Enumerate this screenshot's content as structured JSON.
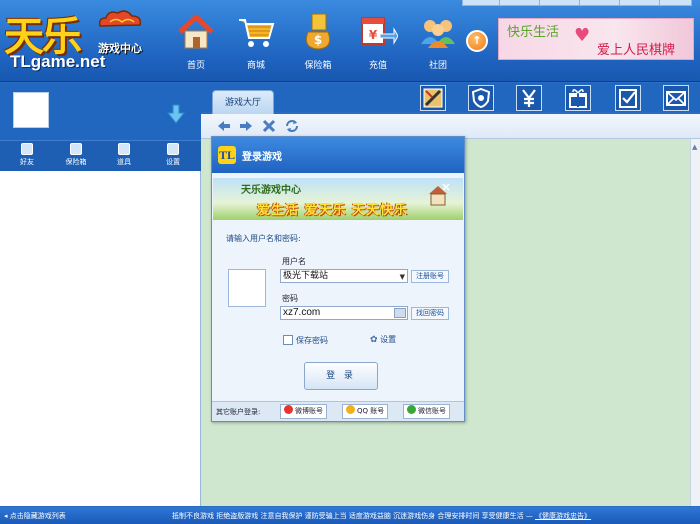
{
  "header": {
    "logo_big": "天乐",
    "logo_sub": "游戏中心",
    "logo_url": "TLgame.net",
    "nav": [
      {
        "label": "首页",
        "icon": "home-icon"
      },
      {
        "label": "商城",
        "icon": "shopping-cart-icon"
      },
      {
        "label": "保险箱",
        "icon": "money-bag-icon"
      },
      {
        "label": "充值",
        "icon": "recharge-card-icon"
      },
      {
        "label": "社团",
        "icon": "community-people-icon"
      }
    ],
    "banner": {
      "line1": "快乐生活",
      "line2": "爱上人民棋牌"
    }
  },
  "tabs": [
    {
      "label": "游戏大厅"
    }
  ],
  "toolbar_icons": [
    "map-icon",
    "shield-icon",
    "yen-icon",
    "gift-icon",
    "checklist-icon",
    "mail-icon"
  ],
  "left_panel": {
    "tools": [
      {
        "label": "好友",
        "icon": "friends-icon"
      },
      {
        "label": "保险箱",
        "icon": "safe-icon"
      },
      {
        "label": "道具",
        "icon": "props-icon"
      },
      {
        "label": "设置",
        "icon": "settings-icon"
      }
    ]
  },
  "login_dialog": {
    "title": "登录游戏",
    "logo_text": "TL",
    "banner_line1": "天乐游戏中心",
    "banner_line2": "爱生活  爱天乐  天天快乐",
    "prompt": "请输入用户名和密码:",
    "username_label": "用户名",
    "username_value": "极光下载站",
    "register_link": "注册账号",
    "password_label": "密码",
    "password_value": "xz7.com",
    "find_password_link": "找回密码",
    "remember_label": "保存密码",
    "settings_label": "设置",
    "login_button": "登 录",
    "other_accounts_label": "其它账户登录:",
    "accounts": [
      {
        "label": "微博账号",
        "color": "#e8352a"
      },
      {
        "label": "QQ 账号",
        "color": "#f2b01a"
      },
      {
        "label": "微信账号",
        "color": "#3aa838"
      }
    ]
  },
  "statusbar": {
    "left": "点击隐藏游戏列表",
    "right": "抵制不良游戏  拒绝盗版游戏  注意自我保护  谨防受骗上当  适度游戏益脑  沉迷游戏伤身  合理安排时间  享受健康生活  —",
    "right_link": "《健康游戏忠告》"
  },
  "colors": {
    "accent": "#2167c0",
    "content_bg": "#cfe6cf",
    "dialog_bg": "#eef4fb"
  }
}
